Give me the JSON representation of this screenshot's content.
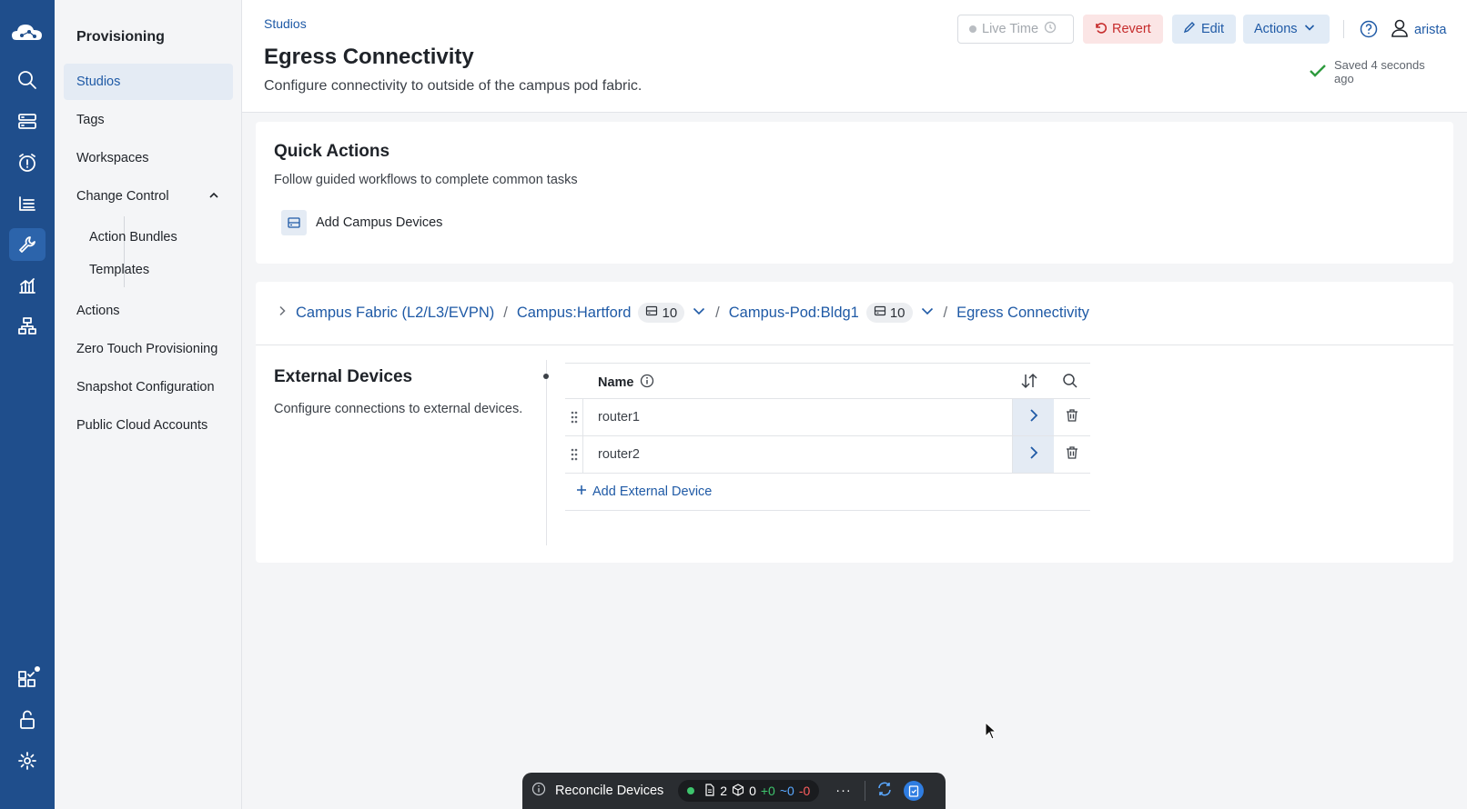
{
  "rail": {
    "icons": [
      "cloud-logo-icon",
      "search-icon",
      "devices-icon",
      "alarm-icon",
      "list-icon",
      "wrench-icon",
      "dashboard-icon",
      "topology-icon",
      "apps-icon",
      "unlock-icon",
      "settings-icon"
    ]
  },
  "sidebar": {
    "title": "Provisioning",
    "items": [
      {
        "label": "Studios"
      },
      {
        "label": "Tags"
      },
      {
        "label": "Workspaces"
      },
      {
        "label": "Change Control"
      },
      {
        "label": "Action Bundles"
      },
      {
        "label": "Templates"
      },
      {
        "label": "Actions"
      },
      {
        "label": "Zero Touch Provisioning"
      },
      {
        "label": "Snapshot Configuration"
      },
      {
        "label": "Public Cloud Accounts"
      }
    ]
  },
  "header": {
    "breadcrumb": "Studios",
    "title": "Egress Connectivity",
    "description": "Configure connectivity to outside of the campus pod fabric.",
    "live_time": "Live Time",
    "revert": "Revert",
    "edit": "Edit",
    "actions": "Actions",
    "user": "arista",
    "saved": "Saved 4 seconds ago"
  },
  "quick_actions": {
    "title": "Quick Actions",
    "description": "Follow guided workflows to complete common tasks",
    "link": "Add Campus Devices"
  },
  "breadcrumb": {
    "items": [
      "Campus Fabric (L2/L3/EVPN)",
      "Campus:Hartford",
      "Campus-Pod:Bldg1",
      "Egress Connectivity"
    ],
    "count1": "10",
    "count2": "10",
    "sep": "/"
  },
  "external": {
    "title": "External Devices",
    "description": "Configure connections to external devices.",
    "column": "Name",
    "rows": [
      "router1",
      "router2"
    ],
    "add": "Add External Device"
  },
  "bottom_bar": {
    "label": "Reconcile Devices",
    "docs": "2",
    "boxes": "0",
    "added": "+0",
    "changed": "~0",
    "removed": "-0",
    "more": "···"
  },
  "colors": {
    "accent": "#1f5aa6",
    "rail": "#1f4e8c",
    "danger": "#c62c2c"
  }
}
